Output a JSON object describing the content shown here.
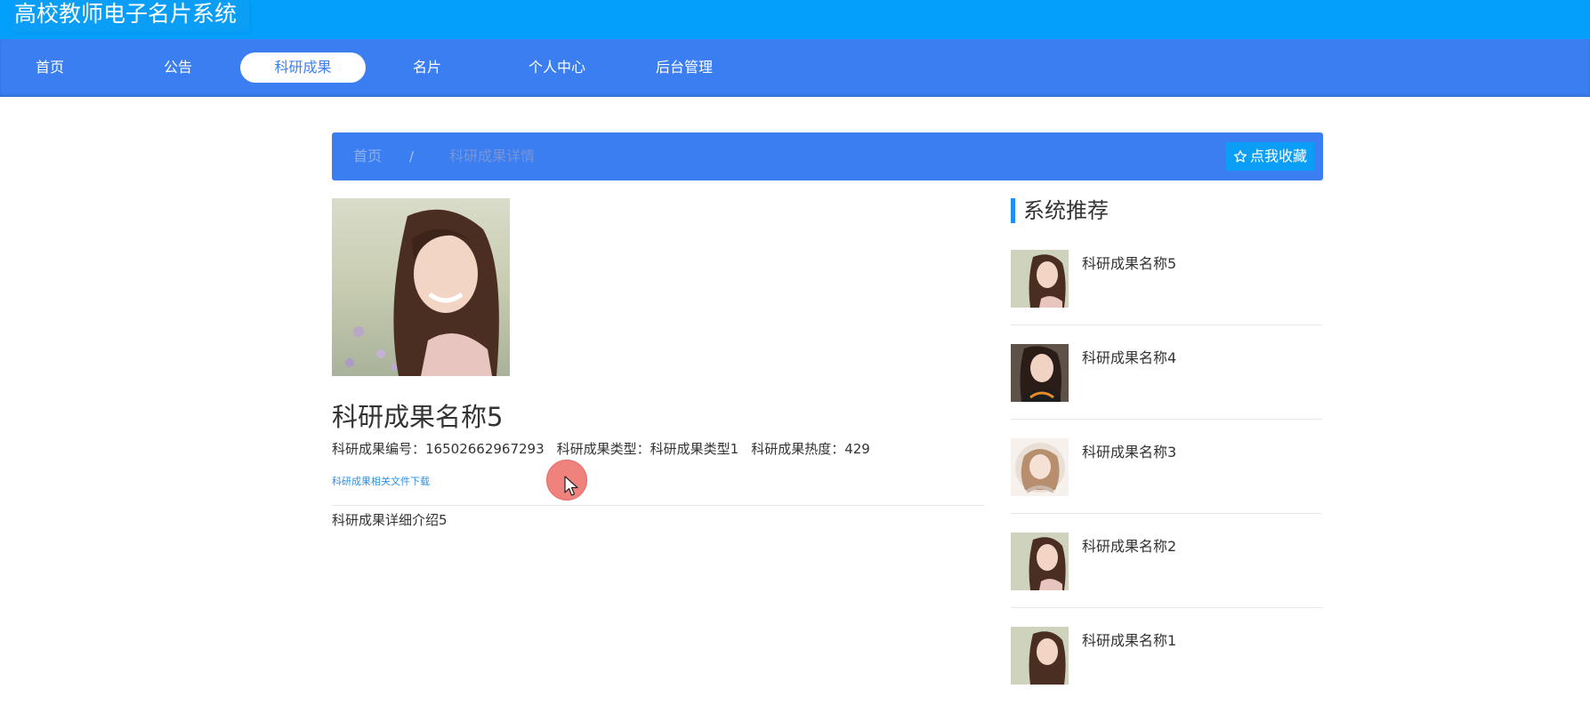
{
  "app": {
    "title": "高校教师电子名片系统"
  },
  "nav": {
    "items": [
      {
        "label": "首页"
      },
      {
        "label": "公告"
      },
      {
        "label": "科研成果",
        "active": true
      },
      {
        "label": "名片"
      },
      {
        "label": "个人中心"
      },
      {
        "label": "后台管理"
      }
    ]
  },
  "breadcrumb": {
    "home": "首页",
    "separator": "/",
    "current": "科研成果详情",
    "favorite_label": "点我收藏",
    "favorite_icon": "star-outline-icon"
  },
  "detail": {
    "title": "科研成果名称5",
    "number_label": "科研成果编号：",
    "number_value": "16502662967293",
    "type_label": "科研成果类型：",
    "type_value": "科研成果类型1",
    "heat_label": "科研成果热度：",
    "heat_value": "429",
    "download_link": "科研成果相关文件下载",
    "intro": "科研成果详细介绍5"
  },
  "sidebar": {
    "heading": "系统推荐",
    "items": [
      {
        "name": "科研成果名称5"
      },
      {
        "name": "科研成果名称4"
      },
      {
        "name": "科研成果名称3"
      },
      {
        "name": "科研成果名称2"
      },
      {
        "name": "科研成果名称1"
      }
    ]
  },
  "colors": {
    "title_bar": "#03a0fb",
    "nav_bar": "#3b7ef2",
    "accent": "#1e90f5",
    "link": "#2b8fe8"
  }
}
